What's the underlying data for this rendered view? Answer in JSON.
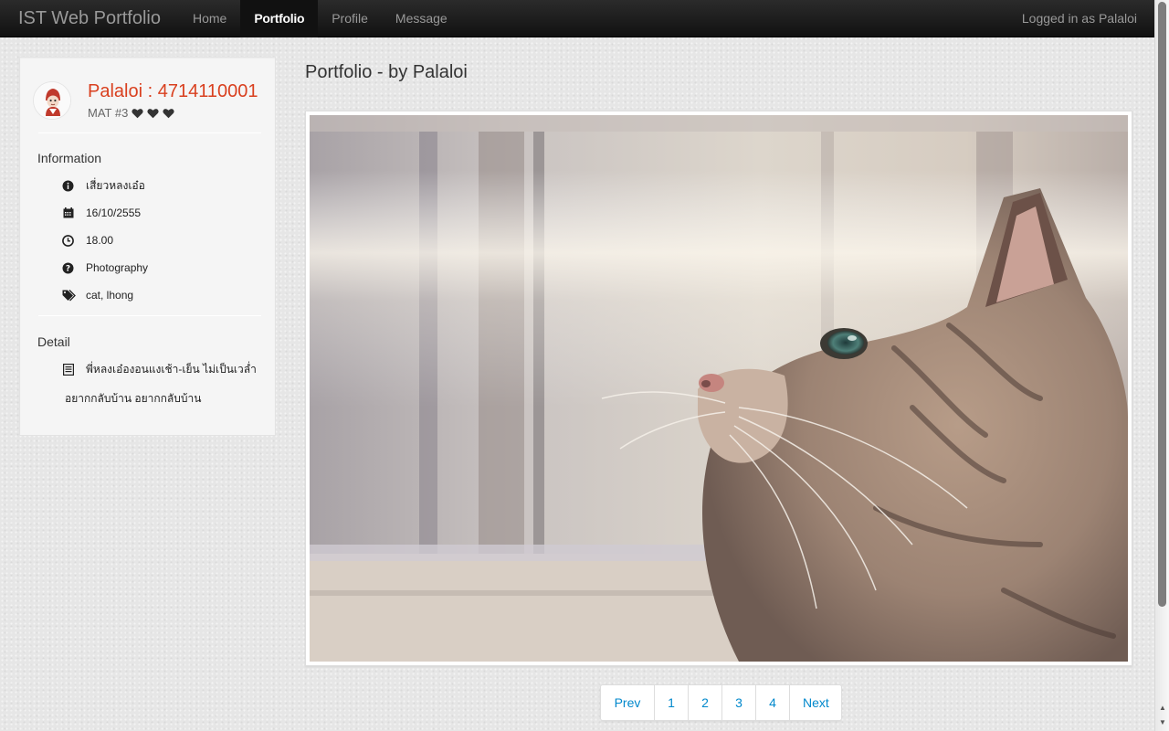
{
  "navbar": {
    "brand": "IST Web Portfolio",
    "items": [
      {
        "label": "Home",
        "active": false
      },
      {
        "label": "Portfolio",
        "active": true
      },
      {
        "label": "Profile",
        "active": false
      },
      {
        "label": "Message",
        "active": false
      }
    ],
    "user_status": "Logged in as Palaloi"
  },
  "sidebar": {
    "user_title": "Palaloi : 4714110001",
    "user_subtitle": "MAT #3",
    "hearts": 3,
    "information_heading": "Information",
    "info": [
      {
        "icon": "info-icon",
        "text": "เสี่ยวหลงเอ๋อ"
      },
      {
        "icon": "calendar-icon",
        "text": "16/10/2555"
      },
      {
        "icon": "clock-icon",
        "text": "18.00"
      },
      {
        "icon": "question-icon",
        "text": "Photography"
      },
      {
        "icon": "tags-icon",
        "text": "cat, lhong"
      }
    ],
    "detail_heading": "Detail",
    "detail_line1": "พี่หลงเอ๋องอนแงเช้า-เย็น ไม่เป็นเวล่ำ",
    "detail_line2": "อยากกลับบ้าน อยากกลับบ้าน"
  },
  "main": {
    "title": "Portfolio - by Palaloi",
    "photo_subject": "cat-photo"
  },
  "pagination": {
    "prev": "Prev",
    "pages": [
      "1",
      "2",
      "3",
      "4"
    ],
    "next": "Next"
  },
  "colors": {
    "accent_red": "#d9401f",
    "link_blue": "#0088cc",
    "navbar_bg": "#1b1b1b"
  }
}
